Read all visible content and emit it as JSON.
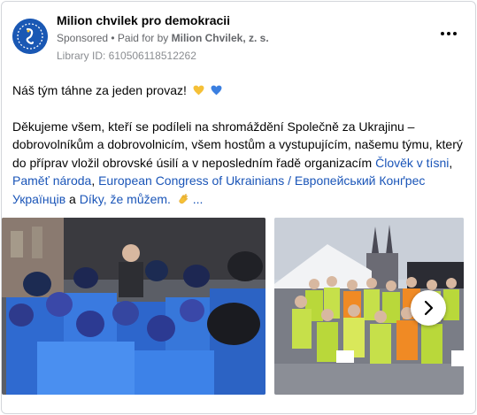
{
  "post": {
    "page_name": "Milion chvilek pro demokracii",
    "sponsored_label": "Sponsored",
    "paid_for_prefix": "• Paid for by",
    "paid_for_name": "Milion Chvilek, z. s.",
    "library_id": "Library ID: 610506118512262",
    "more_icon": "more-options-icon",
    "text": {
      "line1": "Náš tým táhne za jeden provaz!",
      "body_start": "Děkujeme všem, kteří se podíleli na shromáždění Společně za Ukrajinu – dobrovolníkům a dobrovolnicím, všem hostům a vystupujícím, našemu týmu, který do příprav vložil obrovské úsilí a v neposledním řadě organizacím",
      "link1": "Člověk v tísni",
      "sep1": ",",
      "link2": "Paměť národa",
      "sep2": ",",
      "link3": "European Congress of Ukrainians / Европейський Конґрес Українців",
      "mid": "a",
      "link4": "Díky, že můžem.",
      "ellipsis": "..."
    },
    "emoji": {
      "heart1": "yellow-heart-icon",
      "heart2": "blue-heart-icon",
      "clap": "clapping-hands-icon"
    },
    "colors": {
      "link": "#1a55b8",
      "secondary_text": "#65676b",
      "avatar_bg": "#1a58b4",
      "heart_yellow": "#f5c037",
      "heart_blue": "#3b7fe0"
    },
    "carousel": {
      "next_icon": "chevron-right-icon"
    }
  }
}
